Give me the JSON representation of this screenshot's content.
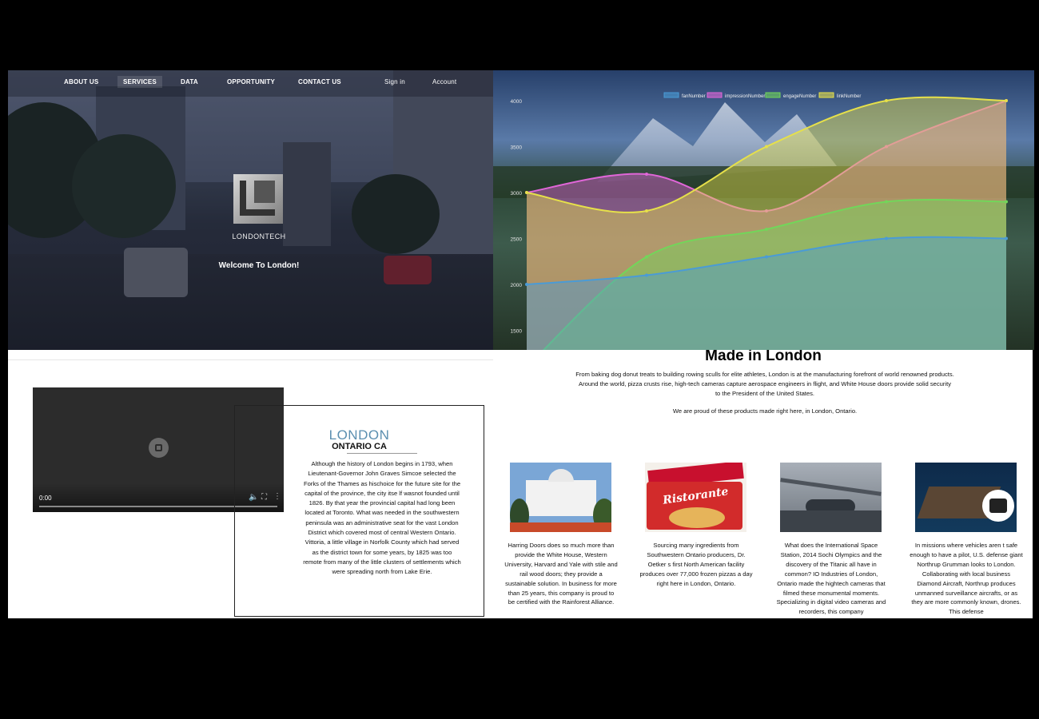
{
  "nav": {
    "items": [
      "ABOUT US",
      "SERVICES",
      "DATA",
      "OPPORTUNITY",
      "CONTACT US"
    ],
    "active": "SERVICES",
    "signin": "Sign in",
    "account": "Account"
  },
  "hero": {
    "logo_text": "LONDONTECH",
    "welcome": "Welcome To London!"
  },
  "chart_data": {
    "type": "area",
    "x": [
      1,
      2,
      3,
      4,
      5
    ],
    "ylim": [
      1200,
      4000
    ],
    "yticks": [
      4000,
      3500,
      3000,
      2500,
      2000,
      1500
    ],
    "legend_position": "top",
    "grid": false,
    "series": [
      {
        "name": "fanNumber",
        "color": "#4a9bd6",
        "values": [
          2000,
          2100,
          2300,
          2500,
          2500
        ]
      },
      {
        "name": "impressionNumber",
        "color": "#e066d8",
        "values": [
          3000,
          3200,
          2800,
          3500,
          4000
        ]
      },
      {
        "name": "engageNumber",
        "color": "#72d65a",
        "values": [
          1100,
          2300,
          2600,
          2900,
          2900
        ]
      },
      {
        "name": "linkNumber",
        "color": "#e6e04a",
        "values": [
          3000,
          2800,
          3500,
          4000,
          4000
        ]
      }
    ]
  },
  "video": {
    "time": "0:00"
  },
  "london": {
    "title": "LONDON",
    "subtitle": "ONTARIO CA",
    "body": "Although the history of London begins in 1793, when Lieutenant-Governor John Graves Simcoe selected the Forks of the Thames as hischoice for the future site for the capital of the province, the city itse lf wasnot founded until 1826. By that year the provincial capital had long been located at Toronto. What was needed in the southwestern peninsula was an administrative seat for the vast London District which covered most of central Western Ontario. Vittoria, a little village in Norfolk County which had served as the district town for some years, by 1825 was too remote from many of the little clusters of settlements which were spreading north from Lake Erie."
  },
  "made": {
    "title": "Made in London",
    "body": "From baking dog donut treats to building rowing sculls for elite athletes, London is at the manufacturing forefront of world renowned products. Around the world, pizza crusts rise, high-tech cameras capture aerospace engineers in flight, and White House doors provide solid security to the President of the United States.",
    "proud": "We are proud of these products made right here, in London, Ontario."
  },
  "cards": [
    {
      "text": "Harring Doors does so much more than provide the White House, Western University, Harvard and Yale with stile and rail wood doors; they provide a sustainable solution. In business for more than 25 years, this company is proud to be certified with the Rainforest Alliance."
    },
    {
      "text": "Sourcing many ingredients from Southwestern Ontario producers, Dr. Oetker s first North American facility produces over 77,000 frozen pizzas a day right here in London, Ontario.",
      "image_brand": "Ristorante"
    },
    {
      "text": "What does the International Space Station, 2014 Sochi Olympics and the discovery of the Titanic all have in common? IO Industries of London, Ontario made the hightech cameras that filmed these monumental moments. Specializing in digital video cameras and recorders, this company"
    },
    {
      "text": "In missions where vehicles aren t safe enough to have a pilot, U.S. defense giant Northrup Grumman looks to London. Collaborating with local business Diamond Aircraft, Northrup produces unmanned surveillance aircrafts, or as they are more commonly known, drones. This defense"
    }
  ]
}
